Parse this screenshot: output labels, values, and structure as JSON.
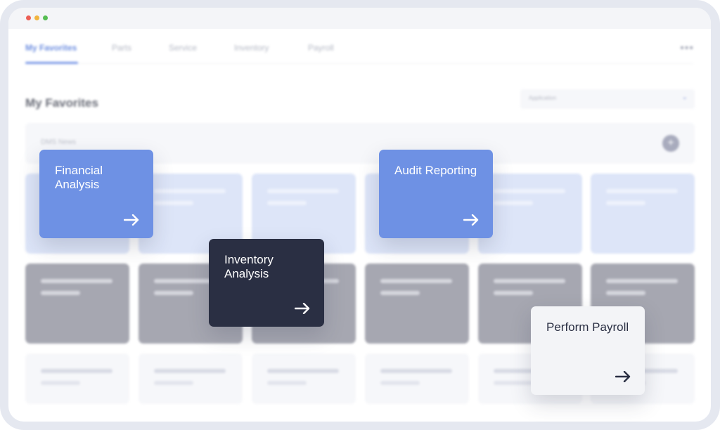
{
  "window": {
    "controls": [
      "close",
      "minimize",
      "maximize"
    ]
  },
  "nav": {
    "tabs": [
      {
        "label": "My Favorites",
        "active": true
      },
      {
        "label": "Parts",
        "active": false
      },
      {
        "label": "Service",
        "active": false
      },
      {
        "label": "Inventory",
        "active": false
      },
      {
        "label": "Payroll",
        "active": false
      }
    ],
    "more_icon": "•••"
  },
  "main": {
    "title": "My Favorites",
    "application_select": {
      "placeholder": "Application",
      "chevron": "⌄"
    },
    "news": {
      "label": "DMS News",
      "add_icon": "+"
    }
  },
  "cards": [
    {
      "title": "Financial Analysis",
      "style": "blue"
    },
    {
      "title": "Audit Reporting",
      "style": "blue"
    },
    {
      "title": "Inventory Analysis",
      "style": "dark"
    },
    {
      "title": "Perform Payroll",
      "style": "light"
    }
  ],
  "colors": {
    "accent_blue": "#6e91e4",
    "dark_card": "#2a2f43",
    "light_card": "#f3f4f7",
    "frame": "#e5e8f0"
  }
}
